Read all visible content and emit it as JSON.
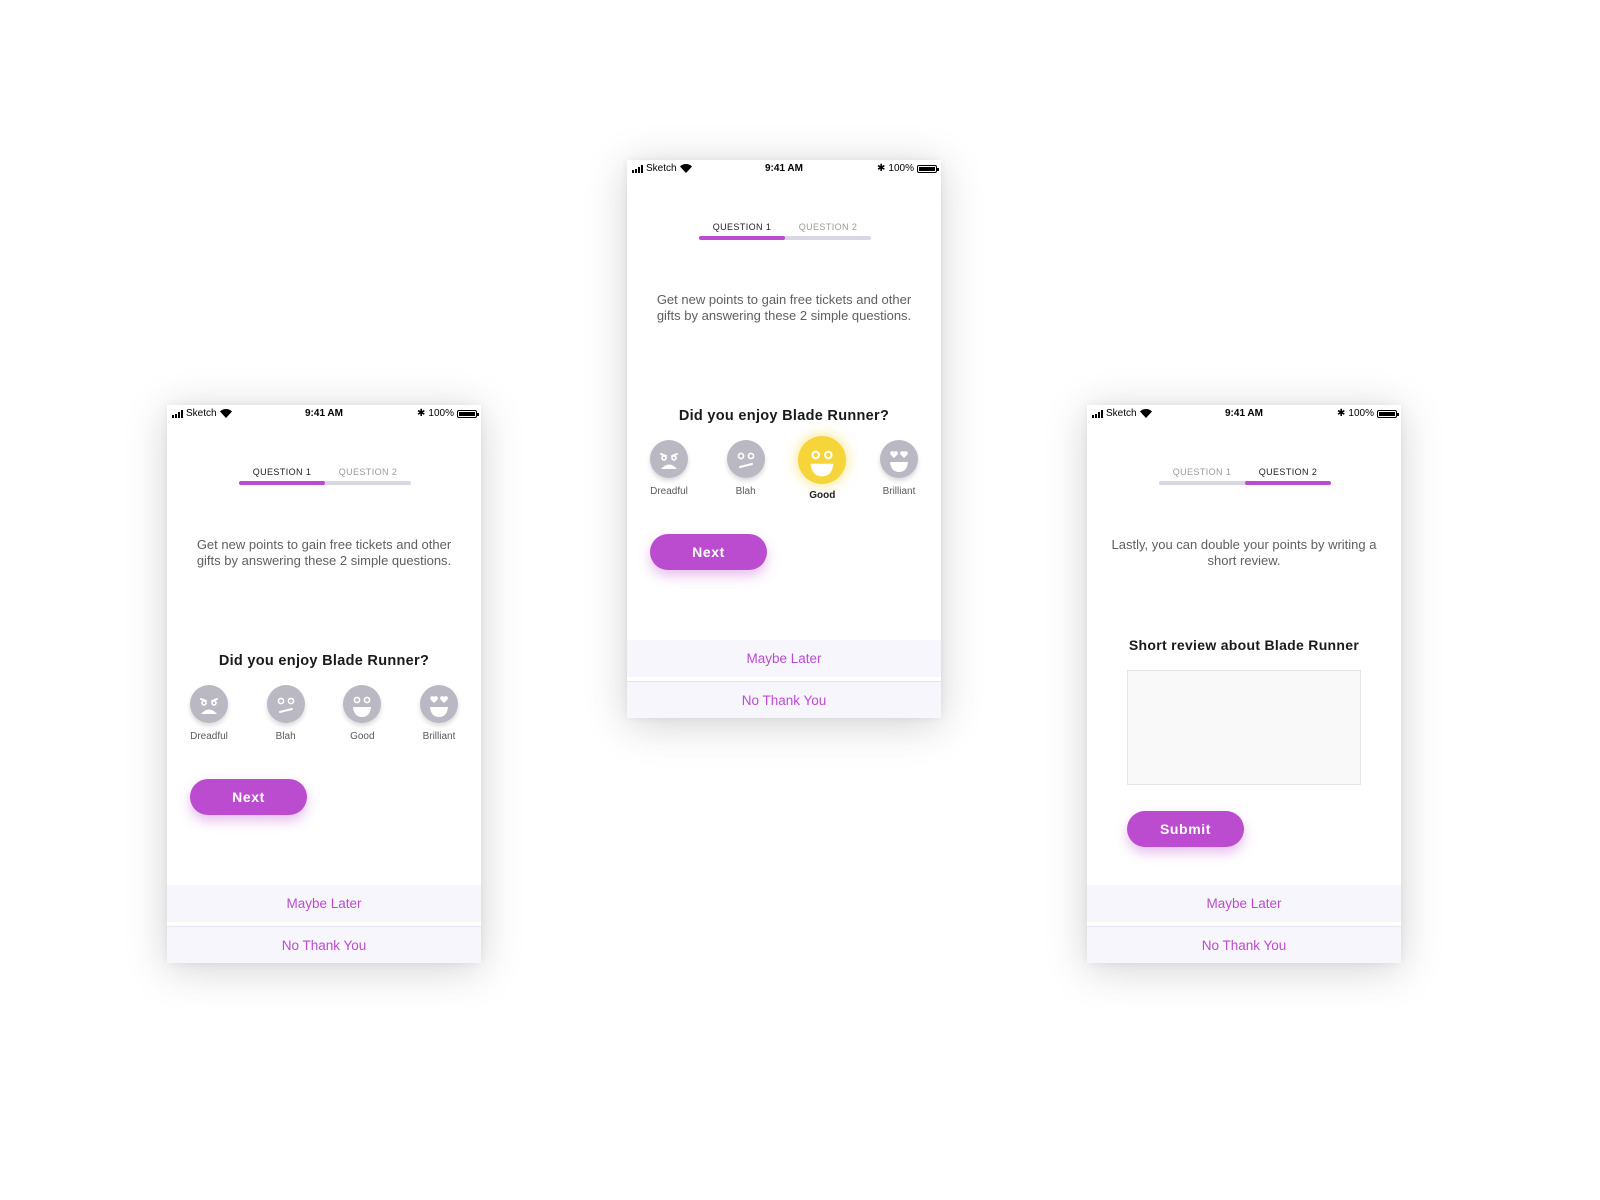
{
  "statusbar": {
    "carrier": "Sketch",
    "time": "9:41 AM",
    "battery": "100%"
  },
  "tabs": [
    "QUESTION 1",
    "QUESTION 2"
  ],
  "colors": {
    "accent": "#bb4bcf",
    "selected_face": "#f6d53a",
    "face": "#b9b8c3",
    "track": "#d9d7e4",
    "footer_bg": "#f7f6fd"
  },
  "screens": {
    "left": {
      "active_tab": 0,
      "progress": 0.5,
      "intro": "Get new points to gain free tickets and other gifts by answering these 2 simple questions.",
      "question": "Did you enjoy Blade Runner?",
      "ratings": [
        {
          "label": "Dreadful",
          "icon": "angry-face-icon",
          "selected": false
        },
        {
          "label": "Blah",
          "icon": "meh-face-icon",
          "selected": false
        },
        {
          "label": "Good",
          "icon": "smile-face-icon",
          "selected": false
        },
        {
          "label": "Brilliant",
          "icon": "heart-eyes-face-icon",
          "selected": false
        }
      ],
      "next_label": "Next"
    },
    "center": {
      "active_tab": 0,
      "progress": 0.5,
      "intro": "Get new points to gain free tickets and other gifts by answering these 2 simple questions.",
      "question": "Did you enjoy Blade Runner?",
      "ratings": [
        {
          "label": "Dreadful",
          "icon": "angry-face-icon",
          "selected": false
        },
        {
          "label": "Blah",
          "icon": "meh-face-icon",
          "selected": false
        },
        {
          "label": "Good",
          "icon": "smile-face-icon",
          "selected": true
        },
        {
          "label": "Brilliant",
          "icon": "heart-eyes-face-icon",
          "selected": false
        }
      ],
      "next_label": "Next"
    },
    "right": {
      "active_tab": 1,
      "progress": 1.0,
      "intro": "Lastly, you can double your points by writing a short review.",
      "review_label": "Short review about Blade Runner",
      "review_value": "",
      "submit_label": "Submit"
    }
  },
  "footer": {
    "maybe_later": "Maybe Later",
    "no_thank_you": "No Thank You"
  }
}
